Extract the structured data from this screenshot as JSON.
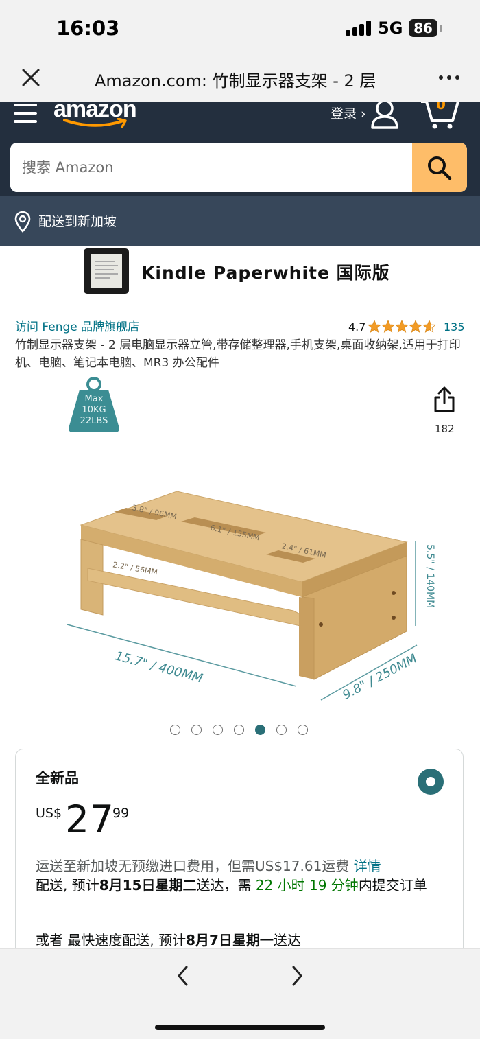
{
  "status_bar": {
    "time": "16:03",
    "network": "5G",
    "battery": "86"
  },
  "browser": {
    "title": "Amazon.com: 竹制显示器支架 - 2 层"
  },
  "header": {
    "logo_text": "amazon",
    "signin_label": "登录 ›",
    "cart_count": "0",
    "search_placeholder": "搜索 Amazon",
    "deliver_to": "配送到新加坡"
  },
  "banner": {
    "title": "Kindle Paperwhite 国际版"
  },
  "product": {
    "brand_link": "访问 Fenge 品牌旗舰店",
    "rating": "4.7",
    "rating_count": "135",
    "title": "竹制显示器支架 - 2 层电脑显示器立管,带存储整理器,手机支架,桌面收纳架,适用于打印机、电脑、笔记本电脑、MR3 办公配件",
    "badge": {
      "line1": "Max",
      "line2": "10KG",
      "line3": "22LBS"
    },
    "share_count": "182",
    "dimensions": {
      "slot1": "3.8\" / 96MM",
      "slot2": "6.1\" / 155MM",
      "slot3": "2.4\" / 61MM",
      "shelf": "2.2\" / 56MM",
      "height": "5.5\" / 140MM",
      "width": "15.7\" / 400MM",
      "depth": "9.8\" / 250MM"
    },
    "image_count": 7,
    "active_image": 5
  },
  "offer": {
    "condition": "全新品",
    "currency": "US$",
    "price_whole": "27",
    "price_fraction": "99",
    "shipping_text": "运送至新加坡无预缴进口费用，但需US$17.61运费",
    "details_link": "详情",
    "delivery_prefix": "配送, 预计",
    "delivery_date": "8月15日星期二",
    "delivery_mid": "送达，需",
    "countdown": "22 小时 19 分钟",
    "delivery_suffix": "内提交订单",
    "fastest_prefix": "或者 最快速度配送, 预计",
    "fastest_date": "8月7日星期一",
    "fastest_suffix": "送达"
  },
  "colors": {
    "amazon_header": "#232f3e",
    "deliver_bar": "#37475a",
    "search_button": "#febd69",
    "link": "#007185",
    "accent_teal": "#2a6f77",
    "countdown_green": "#007600"
  }
}
